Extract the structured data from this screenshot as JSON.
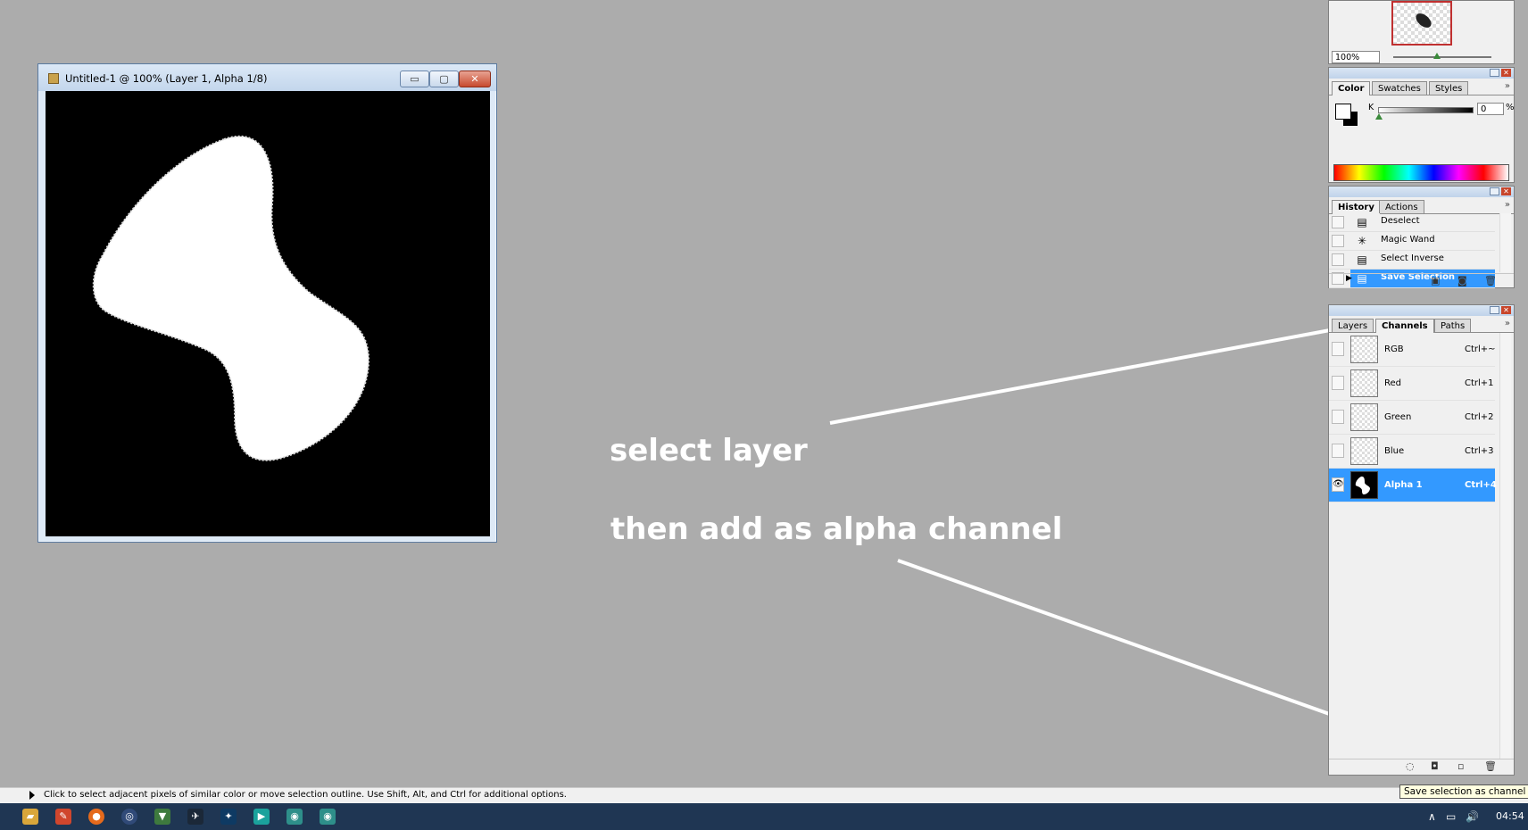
{
  "document": {
    "title": "Untitled-1 @ 100% (Layer 1, Alpha 1/8)",
    "min_glyph": "▭",
    "max_glyph": "▢",
    "close_glyph": "✕"
  },
  "annotations": {
    "line1": "select layer",
    "line2": "then add as alpha channel"
  },
  "navigator": {
    "zoom": "100%"
  },
  "color_panel": {
    "tabs": [
      "Color",
      "Swatches",
      "Styles"
    ],
    "channel_label": "K",
    "value": "0",
    "unit": "%",
    "level": 0
  },
  "history_panel": {
    "tabs": [
      "History",
      "Actions"
    ],
    "items": [
      {
        "label": "Deselect",
        "icon": "document-icon"
      },
      {
        "label": "Magic Wand",
        "icon": "magic-wand-icon"
      },
      {
        "label": "Select Inverse",
        "icon": "document-icon"
      },
      {
        "label": "Save Selection",
        "icon": "document-icon",
        "selected": true
      }
    ]
  },
  "channels_panel": {
    "tabs": [
      "Layers",
      "Channels",
      "Paths"
    ],
    "items": [
      {
        "label": "RGB",
        "shortcut": "Ctrl+~"
      },
      {
        "label": "Red",
        "shortcut": "Ctrl+1"
      },
      {
        "label": "Green",
        "shortcut": "Ctrl+2"
      },
      {
        "label": "Blue",
        "shortcut": "Ctrl+3"
      },
      {
        "label": "Alpha 1",
        "shortcut": "Ctrl+4",
        "selected": true
      }
    ]
  },
  "status": {
    "text": "Click to select adjacent pixels of similar color or move selection outline.  Use Shift, Alt, and Ctrl for additional options.",
    "tooltip": "Save selection as channel"
  },
  "taskbar": {
    "clock": "04:54",
    "icons": [
      "explorer-icon",
      "paint-icon",
      "firefox-icon",
      "app-icon",
      "vector-icon",
      "steam-icon",
      "photoshop-icon",
      "app2-icon",
      "app3-icon",
      "app4-icon"
    ]
  },
  "colors": {
    "selection_blue": "#3399ff",
    "desktop_gray": "#acacac",
    "taskbar": "#1f3653"
  }
}
